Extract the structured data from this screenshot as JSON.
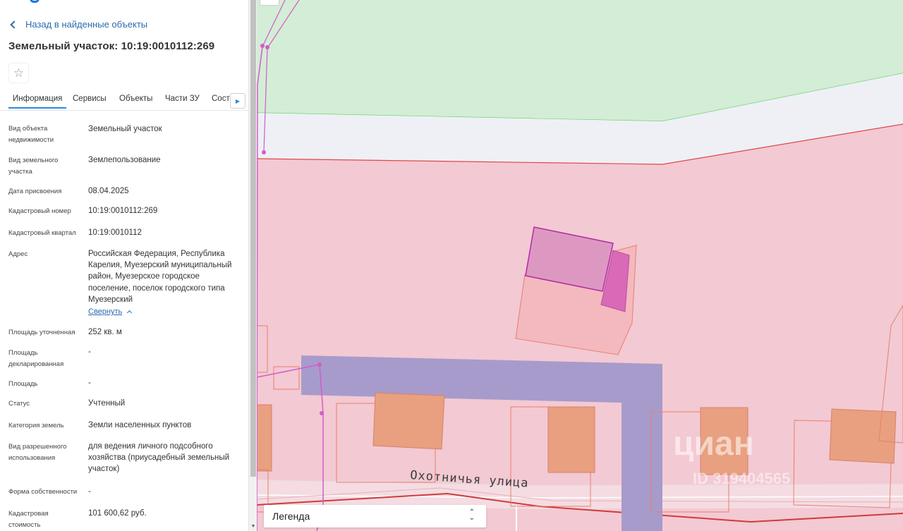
{
  "back_link": "Назад в найденные объекты",
  "page_title": "Земельный участок: 10:19:0010112:269",
  "favorite_icon": "☆",
  "tabs": [
    {
      "label": "Информация",
      "active": true
    },
    {
      "label": "Сервисы"
    },
    {
      "label": "Объекты"
    },
    {
      "label": "Части ЗУ"
    },
    {
      "label": "Сост…"
    }
  ],
  "details": [
    {
      "label": "Вид объекта недвижимости",
      "value": "Земельный участок"
    },
    {
      "label": "Вид земельного участка",
      "value": "Землепользование"
    },
    {
      "label": "Дата присвоения",
      "value": "08.04.2025"
    },
    {
      "label": "Кадастровый номер",
      "value": "10:19:0010112:269"
    },
    {
      "label": "Кадастровый квартал",
      "value": "10:19:0010112"
    },
    {
      "label": "Адрес",
      "value": "Российская Федерация, Республика Карелия, Муезерский муниципальный район, Муезерское городское поселение, поселок городского типа Муезерский"
    },
    {
      "label": "Площадь уточненная",
      "value": "252 кв. м"
    },
    {
      "label": "Площадь декларированная",
      "value": "-"
    },
    {
      "label": "Площадь",
      "value": "-"
    },
    {
      "label": "Статус",
      "value": "Учтенный"
    },
    {
      "label": "Категория земель",
      "value": "Земли населенных пунктов"
    },
    {
      "label": "Вид разрешенного использования",
      "value": "для ведения личного подсобного хозяйства (приусадебный земельный участок)"
    },
    {
      "label": "Форма собственности",
      "value": "-"
    },
    {
      "label": "Кадастровая стоимость",
      "value": "101 600,62 руб."
    }
  ],
  "collapse_link": "Свернуть",
  "map": {
    "street_name": "Охотничья улица",
    "legend_label": "Легенда",
    "watermark": "циан",
    "watermark_id": "ID 319404565",
    "colors": {
      "green_zone": "#d4edd6",
      "pink_zone": "#f3c9d3",
      "parcel_outline": "#b02ba6",
      "building_fill": "#e8a080",
      "road_fill": "#a79bcb",
      "red_line": "#e24646"
    }
  }
}
